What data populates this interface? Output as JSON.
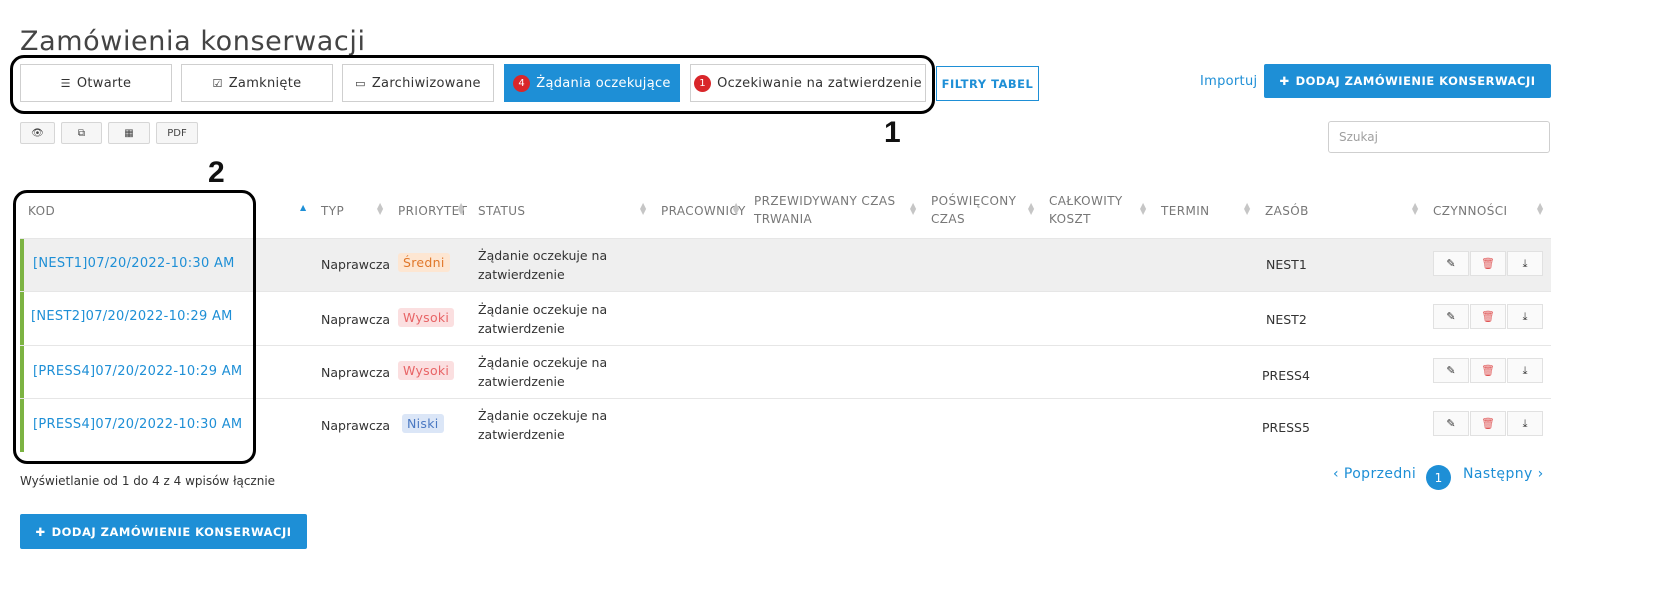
{
  "page_title": "Zamówienia konserwacji",
  "tabs": [
    {
      "label": "Otwarte",
      "icon": "list-icon",
      "active": false
    },
    {
      "label": "Zamknięte",
      "icon": "checkbox-icon",
      "active": false
    },
    {
      "label": "Zarchiwizowane",
      "icon": "inbox-icon",
      "active": false
    },
    {
      "label": "Żądania oczekujące",
      "badge": "4",
      "active": true
    },
    {
      "label": "Oczekiwanie na zatwierdzenie",
      "badge": "1",
      "active": false
    }
  ],
  "table_filters_label": "FILTRY TABEL",
  "import_label": "Importuj",
  "add_order_label": "DODAJ ZAMÓWIENIE KONSERWACJI",
  "toolbar": {
    "pdf_label": "PDF"
  },
  "search": {
    "placeholder": "Szukaj"
  },
  "annotations": [
    "1",
    "2"
  ],
  "columns": [
    "KOD",
    "TYP",
    "PRIORYTET",
    "STATUS",
    "PRACOWNICY",
    "PRZEWIDYWANY CZAS TRWANIA",
    "POŚWIĘCONY CZAS",
    "CAŁKOWITY KOSZT",
    "TERMIN",
    "ZASÓB",
    "CZYNNOŚCI"
  ],
  "columns_split": {
    "expected_1": "PRZEWIDYWANY CZAS",
    "expected_2": "TRWANIA",
    "spent_1": "POŚWIĘCONY",
    "spent_2": "CZAS",
    "cost_1": "CAŁKOWITY",
    "cost_2": "KOSZT"
  },
  "rows": [
    {
      "code": "[NEST1]07/20/2022-10:30 AM",
      "type": "Naprawcza",
      "priority": "Średni",
      "priority_level": "medium",
      "status_1": "Żądanie oczekuje na",
      "status_2": "zatwierdzenie",
      "asset": "NEST1"
    },
    {
      "code": "[NEST2]07/20/2022-10:29 AM",
      "type": "Naprawcza",
      "priority": "Wysoki",
      "priority_level": "high",
      "status_1": "Żądanie oczekuje na",
      "status_2": "zatwierdzenie",
      "asset": "NEST2"
    },
    {
      "code": "[PRESS4]07/20/2022-10:29 AM",
      "type": "Naprawcza",
      "priority": "Wysoki",
      "priority_level": "high",
      "status_1": "Żądanie oczekuje na",
      "status_2": "zatwierdzenie",
      "asset": "PRESS4"
    },
    {
      "code": "[PRESS4]07/20/2022-10:30 AM",
      "type": "Naprawcza",
      "priority": "Niski",
      "priority_level": "low",
      "status_1": "Żądanie oczekuje na",
      "status_2": "zatwierdzenie",
      "asset": "PRESS5"
    }
  ],
  "footer": {
    "info": "Wyświetlanie od 1 do 4 z 4 wpisów łącznie",
    "prev": "Poprzedni",
    "next": "Następny",
    "current_page": "1"
  },
  "colors": {
    "accent": "#1e8fd6",
    "row_marker": "#7cb342",
    "badge": "#d9262a"
  }
}
